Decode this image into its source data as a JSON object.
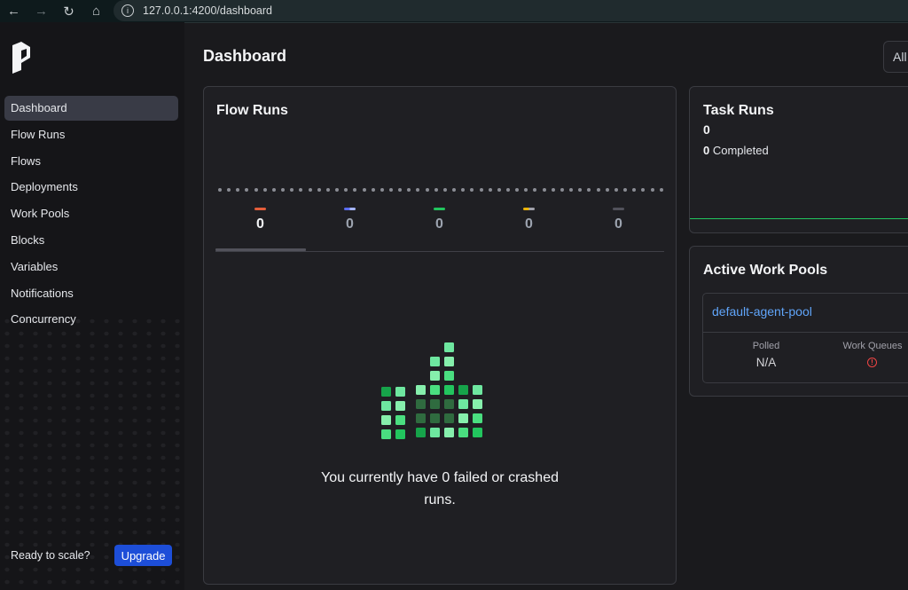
{
  "browser": {
    "url": "127.0.0.1:4200/dashboard",
    "icons": [
      "back-arrow-icon",
      "forward-arrow-icon",
      "reload-icon",
      "home-icon",
      "site-info-icon"
    ]
  },
  "sidebar": {
    "items": [
      {
        "label": "Dashboard",
        "active": true
      },
      {
        "label": "Flow Runs"
      },
      {
        "label": "Flows"
      },
      {
        "label": "Deployments"
      },
      {
        "label": "Work Pools"
      },
      {
        "label": "Blocks"
      },
      {
        "label": "Variables"
      },
      {
        "label": "Notifications"
      },
      {
        "label": "Concurrency"
      }
    ],
    "scale_text": "Ready to scale?",
    "upgrade_label": "Upgrade"
  },
  "header": {
    "title": "Dashboard",
    "filter_label": "All"
  },
  "flow_runs": {
    "title": "Flow Runs",
    "states": [
      {
        "count": "0",
        "color": "#e45d3a"
      },
      {
        "count": "0",
        "color": "#5b6cf0"
      },
      {
        "count": "0",
        "color": "#22c55e"
      },
      {
        "count": "0",
        "color": "#eab308"
      },
      {
        "count": "0",
        "color": "#52525b"
      }
    ],
    "empty_message": "You currently have 0 failed or crashed runs."
  },
  "task_runs": {
    "title": "Task Runs",
    "total": "0",
    "completed_count": "0",
    "completed_label": "Completed"
  },
  "work_pools": {
    "title": "Active Work Pools",
    "pool_name": "default-agent-pool",
    "polled_label": "Polled",
    "polled_value": "N/A",
    "queues_label": "Work Queues"
  },
  "colors": {
    "accent": "#1d4ed8",
    "link": "#60a5fa",
    "success": "#22c55e",
    "error": "#ef4444"
  }
}
